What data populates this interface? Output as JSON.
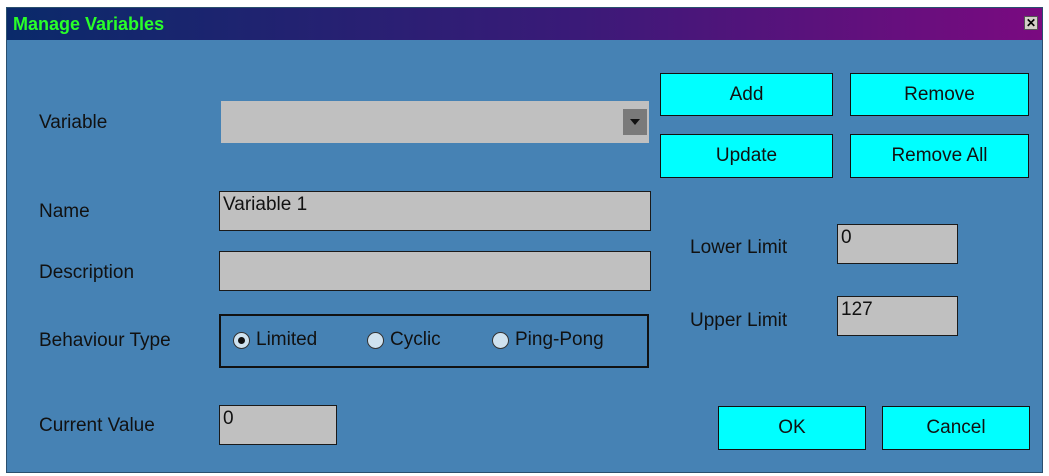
{
  "window": {
    "title": "Manage Variables",
    "close_glyph": "✕"
  },
  "variable": {
    "label": "Variable",
    "selected": ""
  },
  "buttons": {
    "add": "Add",
    "remove": "Remove",
    "update": "Update",
    "remove_all": "Remove All",
    "ok": "OK",
    "cancel": "Cancel"
  },
  "name": {
    "label": "Name",
    "value": "Variable 1"
  },
  "description": {
    "label": "Description",
    "value": ""
  },
  "behaviour": {
    "label": "Behaviour Type",
    "options": [
      {
        "label": "Limited",
        "selected": true
      },
      {
        "label": "Cyclic",
        "selected": false
      },
      {
        "label": "Ping-Pong",
        "selected": false
      }
    ]
  },
  "current_value": {
    "label": "Current Value",
    "value": "0"
  },
  "lower_limit": {
    "label": "Lower Limit",
    "value": "0"
  },
  "upper_limit": {
    "label": "Upper Limit",
    "value": "127"
  },
  "colors": {
    "window_bg": "#4682b4",
    "button_bg": "#00ffff",
    "title_text": "#29ff29",
    "field_bg": "#c0c0c0"
  }
}
